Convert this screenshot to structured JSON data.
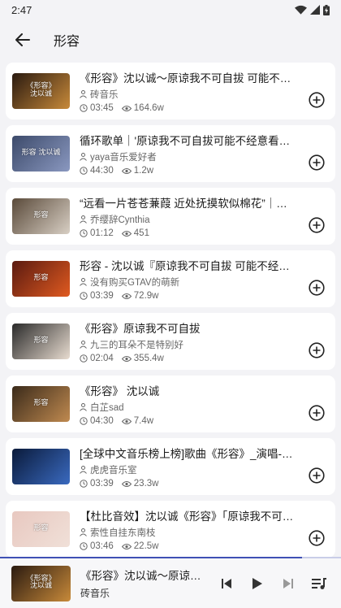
{
  "status_bar": {
    "time": "2:47"
  },
  "header": {
    "title": "形容"
  },
  "colors": {
    "accent": "#3f51b5",
    "card_bg": "#ffffff",
    "page_bg": "#f3f3f6"
  },
  "songs": [
    {
      "title": "《形容》沈以诚～原谅我不可自拔 可能不经意看…",
      "artist": "砖音乐",
      "duration": "03:45",
      "plays": "164.6w",
      "thumb_text": "《形容》\n沈以诚",
      "thumb_colors": [
        "#2a1a10",
        "#c88a3a"
      ]
    },
    {
      "title": "循环歌单｜'原谅我不可自拔可能不经意看你一眼…",
      "artist": "yaya音乐爱好者",
      "duration": "44:30",
      "plays": "1.2w",
      "thumb_text": "形容  沈以诚",
      "thumb_colors": [
        "#3c4a6a",
        "#8a98c0"
      ]
    },
    {
      "title": "“远看一片苍苍蒹葭 近处抚摸软似棉花”｜沈以诚《…",
      "artist": "乔缨辞Cynthia",
      "duration": "01:12",
      "plays": "451",
      "thumb_text": "形容",
      "thumb_colors": [
        "#5a4a3a",
        "#d8cfc4"
      ]
    },
    {
      "title": "形容 - 沈以诚『原谅我不可自拔 可能不经意看你一…",
      "artist": "没有购买GTAV的萌新",
      "duration": "03:39",
      "plays": "72.9w",
      "thumb_text": "形容",
      "thumb_colors": [
        "#5a1a10",
        "#e05a20"
      ]
    },
    {
      "title": "《形容》原谅我不可自拔",
      "artist": "九三的耳朵不是特别好",
      "duration": "02:04",
      "plays": "355.4w",
      "thumb_text": "形容",
      "thumb_colors": [
        "#2a2a2a",
        "#e8dcd0"
      ]
    },
    {
      "title": "《形容》 沈以诚",
      "artist": "白芷sad",
      "duration": "04:30",
      "plays": "7.4w",
      "thumb_text": "形容",
      "thumb_colors": [
        "#3a2a1a",
        "#c08a50"
      ]
    },
    {
      "title": "[全球中文音乐榜上榜]歌曲《形容》_演唱-沈以诚",
      "artist": "虎虎音乐室",
      "duration": "03:39",
      "plays": "23.3w",
      "thumb_text": "",
      "thumb_colors": [
        "#0a1a3a",
        "#3a6ac0"
      ]
    },
    {
      "title": "【杜比音效】沈以诚《形容》「原谅我不可自拔 …",
      "artist": "索性自挂东南枝",
      "duration": "03:46",
      "plays": "22.5w",
      "thumb_text": "形容",
      "thumb_colors": [
        "#e8c8c0",
        "#f0e0d8"
      ]
    }
  ],
  "player": {
    "title": "《形容》沈以诚～原谅…",
    "artist": "砖音乐",
    "thumb_text": "《形容》\n沈以诚",
    "progress": 0.885
  }
}
